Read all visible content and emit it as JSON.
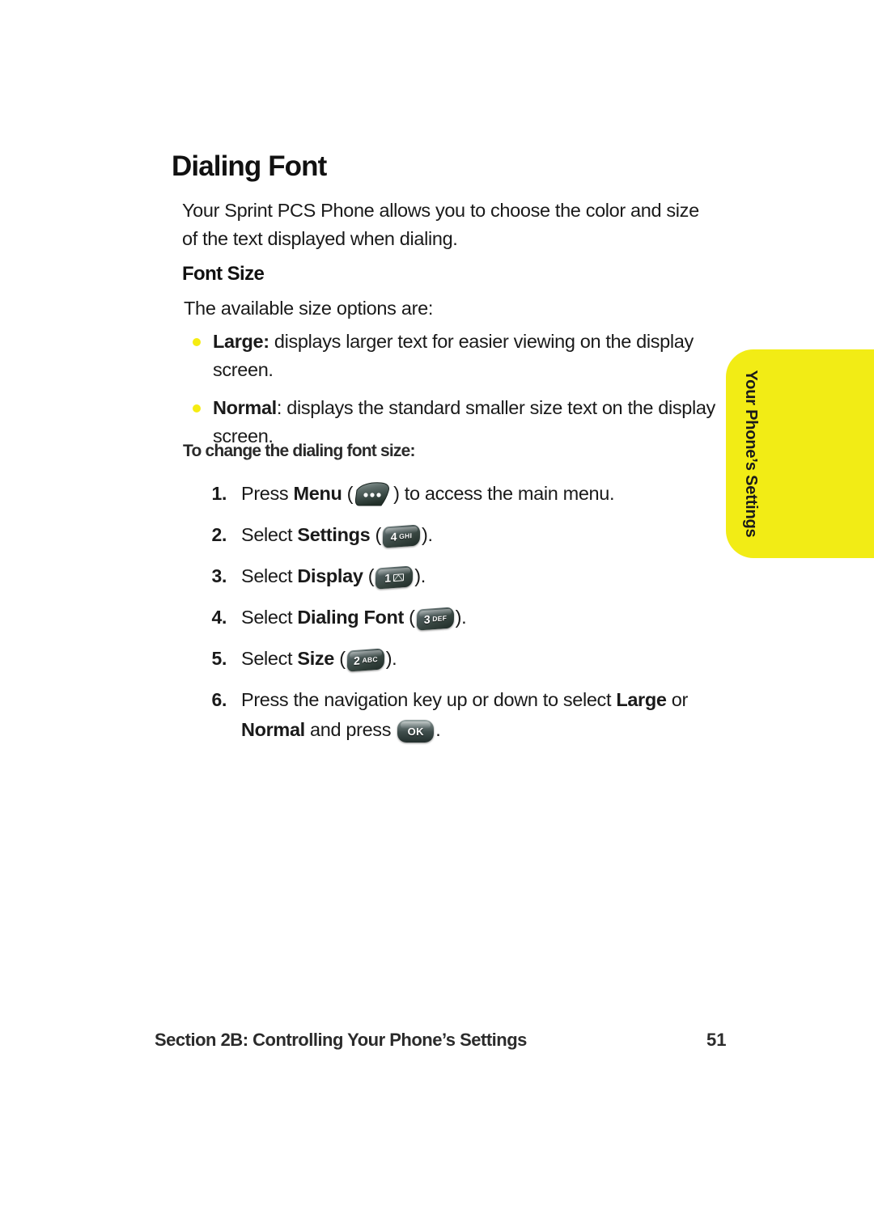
{
  "page": {
    "title": "Dialing Font",
    "intro": "Your Sprint PCS Phone allows you to choose the color and size of the text displayed when dialing.",
    "section_heading": "Font Size",
    "options_lead": "The available size options are:",
    "procedure_heading": "To change the dialing font size:"
  },
  "bullets": [
    {
      "bold": "Large:",
      "text": " displays larger text for easier viewing on the display screen."
    },
    {
      "bold": "Normal",
      "text": ": displays the standard smaller size text on the display screen."
    }
  ],
  "steps": [
    {
      "number": "1.",
      "before": "Press ",
      "bold": "Menu",
      "mid": " (",
      "key": {
        "type": "menu",
        "name": "menu-key-icon",
        "digit": "",
        "letters": ""
      },
      "after": ") to access the main menu."
    },
    {
      "number": "2.",
      "before": "Select ",
      "bold": "Settings",
      "mid": " (",
      "key": {
        "type": "num",
        "name": "key-4-ghi-icon",
        "digit": "4",
        "letters": "GHI"
      },
      "after": ")."
    },
    {
      "number": "3.",
      "before": "Select ",
      "bold": "Display",
      "mid": " (",
      "key": {
        "type": "num-envelope",
        "name": "key-1-envelope-icon",
        "digit": "1",
        "letters": ""
      },
      "after": ")."
    },
    {
      "number": "4.",
      "before": "Select ",
      "bold": "Dialing Font",
      "mid": " (",
      "key": {
        "type": "num",
        "name": "key-3-def-icon",
        "digit": "3",
        "letters": "DEF"
      },
      "after": ")."
    },
    {
      "number": "5.",
      "before": "Select ",
      "bold": "Size",
      "mid": " (",
      "key": {
        "type": "num",
        "name": "key-2-abc-icon",
        "digit": "2",
        "letters": "ABC"
      },
      "after": ")."
    },
    {
      "number": "6.",
      "before": "Press the navigation key up or down to select ",
      "bold": "Large",
      "mid": " or ",
      "bold2": "Normal",
      "mid2": " and press ",
      "key": {
        "type": "ok",
        "name": "ok-key-icon",
        "digit": "OK",
        "letters": ""
      },
      "after": "."
    }
  ],
  "side_tab": {
    "label": "Your Phone’s Settings",
    "color": "#f2ec15"
  },
  "footer": {
    "section": "Section 2B: Controlling Your Phone’s Settings",
    "page_number": "51"
  }
}
